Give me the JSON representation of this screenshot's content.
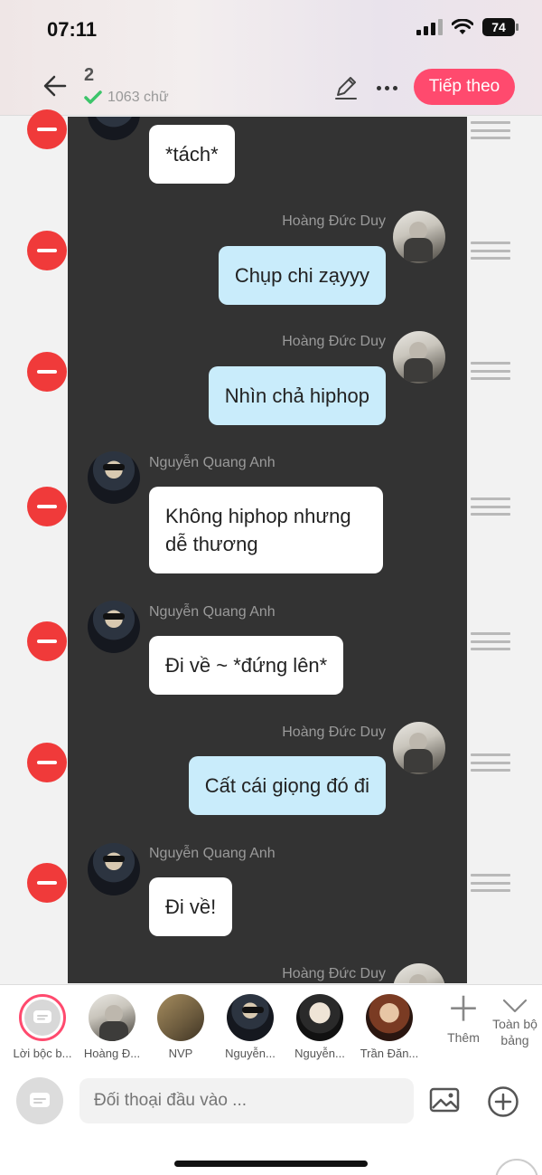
{
  "status_bar": {
    "time": "07:11",
    "battery": "74"
  },
  "header": {
    "number": "2",
    "word_count": "1063 chữ",
    "next_label": "Tiếp theo"
  },
  "messages": [
    {
      "speaker": "",
      "text": "*tách*",
      "side": "left"
    },
    {
      "speaker": "Hoàng Đức Duy",
      "text": "Chụp chi zạyyy",
      "side": "right"
    },
    {
      "speaker": "Hoàng Đức Duy",
      "text": "Nhìn chả hiphop",
      "side": "right"
    },
    {
      "speaker": "Nguyễn Quang Anh",
      "text": "Không hiphop nhưng dễ thương",
      "side": "left"
    },
    {
      "speaker": "Nguyễn Quang Anh",
      "text": "Đi về ~ *đứng lên*",
      "side": "left"
    },
    {
      "speaker": "Hoàng Đức Duy",
      "text": "Cất cái giọng đó đi",
      "side": "right"
    },
    {
      "speaker": "Nguyễn Quang Anh",
      "text": "Đi về!",
      "side": "left"
    },
    {
      "speaker": "Hoàng Đức Duy",
      "text": "",
      "side": "right"
    }
  ],
  "speakers": [
    {
      "label": "Lời bộc b..."
    },
    {
      "label": "Hoàng Đ..."
    },
    {
      "label": "NVP"
    },
    {
      "label": "Nguyễn..."
    },
    {
      "label": "Nguyễn..."
    },
    {
      "label": "Trần Đăn..."
    }
  ],
  "speaker_actions": {
    "more_label": "Thêm",
    "collapse_label": "Toàn bộ bảng"
  },
  "composer": {
    "placeholder": "Đối thoại đầu vào ..."
  },
  "colors": {
    "accent": "#ff4a6e",
    "chat_bg": "#333333",
    "right_bubble": "#c9ecfb",
    "delete": "#f03a3a"
  }
}
